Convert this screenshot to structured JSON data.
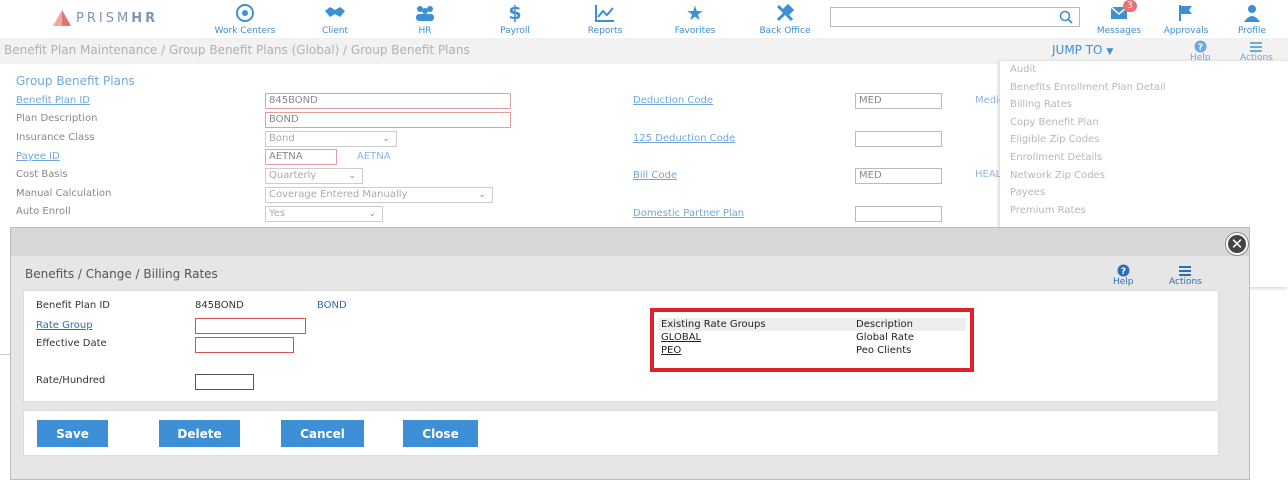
{
  "brand": {
    "logo_text": "PRISM",
    "logo_bold": "HR"
  },
  "nav": {
    "items": [
      {
        "label": "Work Centers",
        "icon": "work-centers-icon"
      },
      {
        "label": "Client",
        "icon": "handshake-icon"
      },
      {
        "label": "HR",
        "icon": "people-icon"
      },
      {
        "label": "Payroll",
        "icon": "dollar-icon"
      },
      {
        "label": "Reports",
        "icon": "chart-icon"
      },
      {
        "label": "Favorites",
        "icon": "star-icon"
      },
      {
        "label": "Back Office",
        "icon": "tools-icon"
      }
    ],
    "search": {
      "value": "",
      "placeholder": ""
    },
    "right": [
      {
        "label": "Messages",
        "icon": "messages-icon",
        "badge": "3"
      },
      {
        "label": "Approvals",
        "icon": "flag-icon"
      },
      {
        "label": "Profile",
        "icon": "user-icon"
      }
    ]
  },
  "header": {
    "breadcrumb": "Benefit Plan Maintenance / Group Benefit Plans (Global) / Group Benefit Plans",
    "jump_to": "JUMP TO",
    "help": "Help",
    "actions": "Actions"
  },
  "bg_form": {
    "title": "Group Benefit Plans",
    "benefit_plan_id_label": "Benefit Plan ID",
    "benefit_plan_id": "845BOND",
    "plan_description_label": "Plan Description",
    "plan_description": "BOND",
    "insurance_class_label": "Insurance Class",
    "insurance_class": "Bond",
    "payee_id_label": "Payee ID",
    "payee_id": "AETNA",
    "payee_name": "AETNA",
    "cost_basis_label": "Cost Basis",
    "cost_basis": "Quarterly",
    "manual_calc_label": "Manual Calculation",
    "manual_calc": "Coverage Entered Manually",
    "auto_enroll_label": "Auto Enroll",
    "auto_enroll": "Yes",
    "deduction_code_label": "Deduction Code",
    "deduction_code": "MED",
    "deduction_desc": "Medic",
    "deduction_125_label": "125 Deduction Code",
    "deduction_125": "",
    "bill_code_label": "Bill Code",
    "bill_code": "MED",
    "bill_desc": "HEAL",
    "domestic_partner_label": "Domestic Partner Plan",
    "domestic_partner": ""
  },
  "actions_menu": [
    "Audit",
    "Benefits Enrollment Plan Detail",
    "Billing Rates",
    "Copy Benefit Plan",
    "Eligible Zip Codes",
    "Enrollment Details",
    "Network Zip Codes",
    "Payees",
    "Premium Rates"
  ],
  "modal": {
    "title": "Benefits / Change / Billing Rates",
    "help": "Help",
    "actions": "Actions",
    "benefit_plan_id_label": "Benefit Plan ID",
    "benefit_plan_id": "845BOND",
    "benefit_plan_desc": "BOND",
    "rate_group_label": "Rate Group",
    "rate_group": "",
    "effective_date_label": "Effective Date",
    "effective_date": "",
    "rate_hundred_label": "Rate/Hundred",
    "rate_hundred": "",
    "rate_groups": {
      "headers": [
        "Existing Rate Groups",
        "Description"
      ],
      "rows": [
        {
          "group": "GLOBAL",
          "description": "Global Rate"
        },
        {
          "group": "PEO",
          "description": "Peo Clients"
        }
      ]
    },
    "buttons": {
      "save": "Save",
      "delete": "Delete",
      "cancel": "Cancel",
      "close": "Close"
    }
  },
  "colors": {
    "accent": "#3d8fd6",
    "highlight": "#e0202a",
    "button": "#3d8fd6"
  }
}
